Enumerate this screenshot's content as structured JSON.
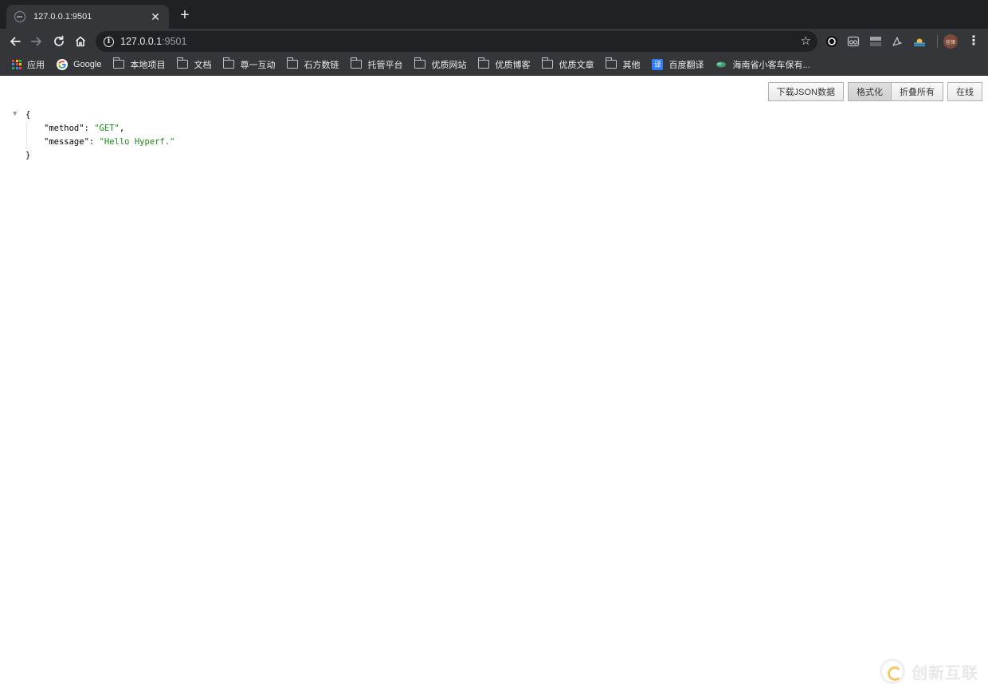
{
  "tab": {
    "title": "127.0.0.1:9501",
    "close_glyph": "✕",
    "new_tab_glyph": "+"
  },
  "toolbar": {
    "url_host": "127.0.0.1",
    "url_port": ":9501",
    "info_glyph": "i",
    "star_glyph": "☆",
    "menu_glyph": "⋮",
    "avatar_text": "桂锋"
  },
  "bookmarks": [
    {
      "label": "应用",
      "icon": "apps-grid-icon"
    },
    {
      "label": "Google",
      "icon": "google-icon"
    },
    {
      "label": "本地项目",
      "icon": "folder-icon"
    },
    {
      "label": "文档",
      "icon": "folder-icon"
    },
    {
      "label": "尊一互动",
      "icon": "folder-icon"
    },
    {
      "label": "石方数链",
      "icon": "folder-icon"
    },
    {
      "label": "托管平台",
      "icon": "folder-icon"
    },
    {
      "label": "优质网站",
      "icon": "folder-icon"
    },
    {
      "label": "优质博客",
      "icon": "folder-icon"
    },
    {
      "label": "优质文章",
      "icon": "folder-icon"
    },
    {
      "label": "其他",
      "icon": "folder-icon"
    },
    {
      "label": "百度翻译",
      "icon": "translate-icon",
      "icon_text": "译"
    },
    {
      "label": "海南省小客车保有...",
      "icon": "leaf-icon"
    }
  ],
  "viewer": {
    "download_label": "下载JSON数据",
    "format_label": "格式化",
    "collapse_label": "折叠所有",
    "online_label": "在线",
    "toggle_glyph": "▼"
  },
  "json": {
    "open_brace": "{",
    "close_brace": "}",
    "rows": [
      {
        "key": "\"method\"",
        "sep": ": ",
        "value": "\"GET\"",
        "trail": ","
      },
      {
        "key": "\"message\"",
        "sep": ": ",
        "value": "\"Hello Hyperf.\"",
        "trail": ""
      }
    ]
  },
  "watermark": {
    "text": "创新互联"
  },
  "colors": {
    "tabstrip": "#202124",
    "toolbar": "#35363a",
    "string_value": "#1a8a1a"
  }
}
